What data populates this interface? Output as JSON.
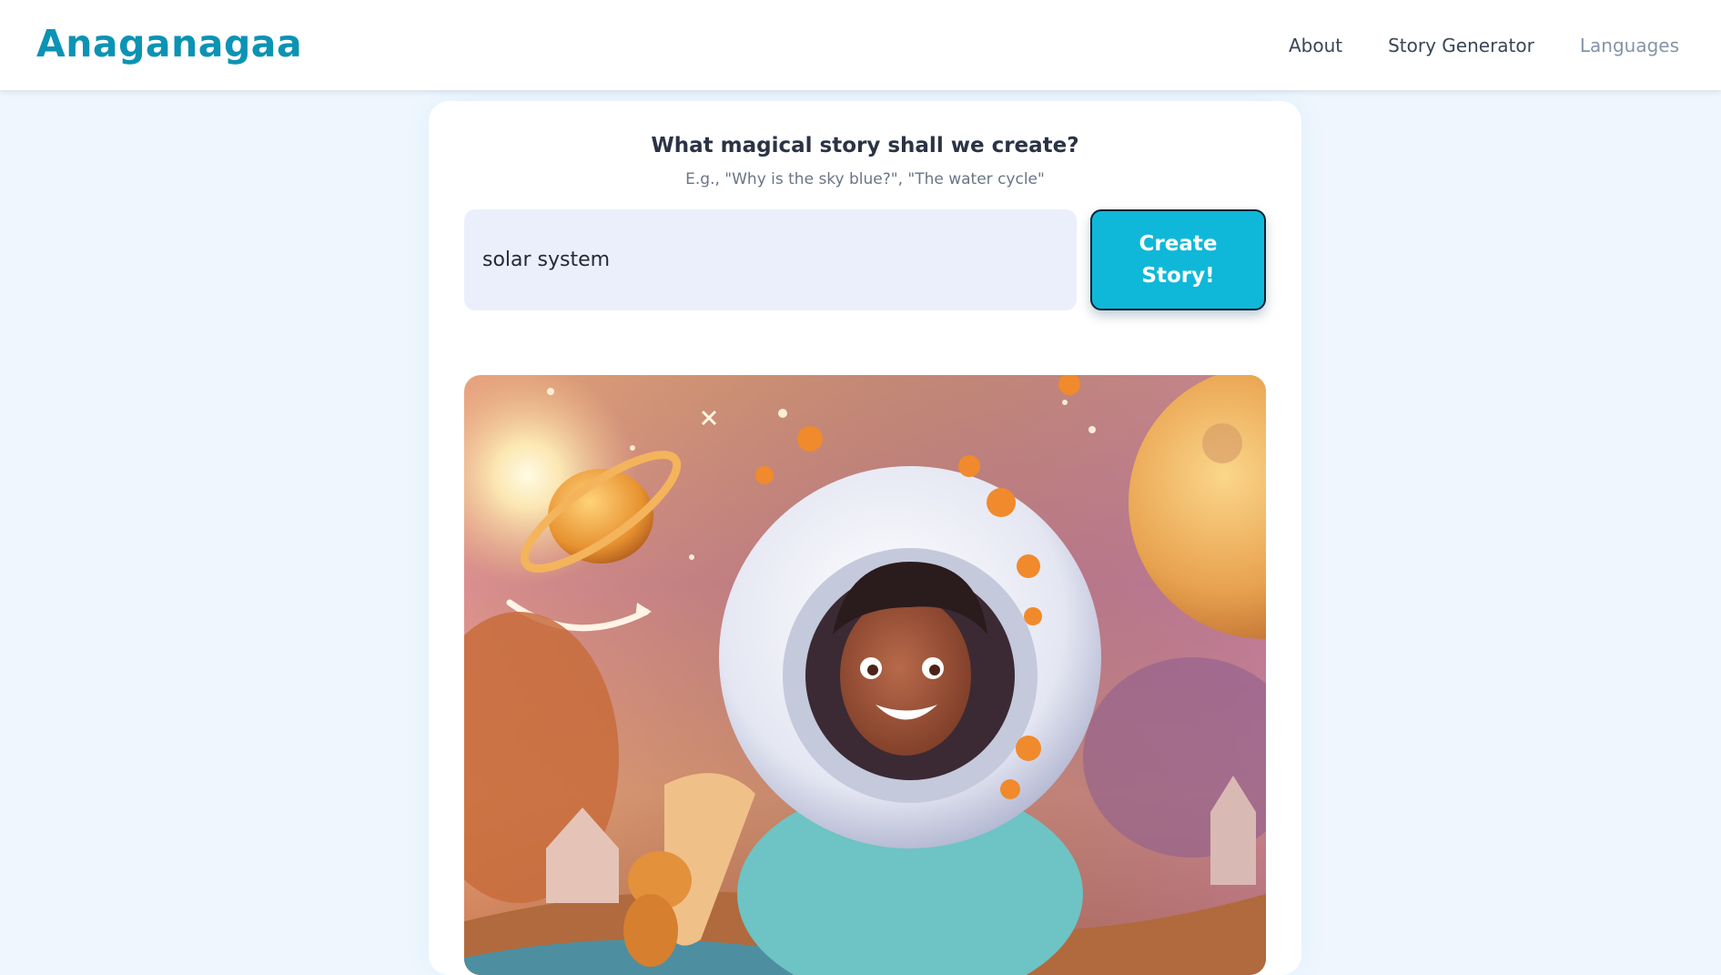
{
  "header": {
    "logo": "Anaganagaa",
    "nav": [
      {
        "label": "About"
      },
      {
        "label": "Story Generator"
      },
      {
        "label": "Languages"
      }
    ]
  },
  "main": {
    "prompt_title": "What magical story shall we create?",
    "prompt_hint": "E.g., \"Why is the sky blue?\", \"The water cycle\"",
    "topic_input": {
      "value": "solar system"
    },
    "create_button_label": "Create Story!"
  },
  "colors": {
    "brand": "#0c93b4",
    "button": "#0fb8d8",
    "page_background": "#eff6fd",
    "input_background": "#ebeffc"
  }
}
